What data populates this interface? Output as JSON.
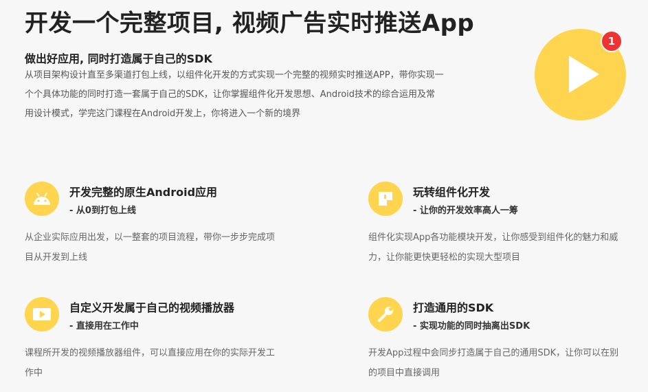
{
  "hero": {
    "title": "开发一个完整项目, 视频广告实时推送App",
    "subtitle": "做出好应用, 同时打造属于自己的SDK",
    "description": "从项目架构设计直至多渠道打包上线，以组件化开发的方式实现一个完整的视频实时推送APP，带你实现一个个具体功能的同时打造一套属于自己的SDK，让你掌握组件化开发思想、Android技术的综合运用及常用设计模式，学完这门课程在Android开发上，你将进入一个新的境界",
    "badge_count": "1"
  },
  "features": [
    {
      "icon": "android-icon",
      "title": "开发完整的原生Android应用",
      "subtitle": "- 从0到打包上线",
      "description": "从企业实际应用出发，以一整套的项目流程，带你一步步完成项目从开发到上线"
    },
    {
      "icon": "layout-icon",
      "title": "玩转组件化开发",
      "subtitle": "- 让你的开发效率高人一筹",
      "description": "组件化实现App各功能模块开发，让你感受到组件化的魅力和威力，让你能更快更轻松的实现大型项目"
    },
    {
      "icon": "video-player-icon",
      "title": "自定义开发属于自己的视频播放器",
      "subtitle": "- 直接用在工作中",
      "description": "课程所开发的视频播放器组件，可以直接应用在你的实际开发工作中"
    },
    {
      "icon": "wrench-icon",
      "title": "打造通用的SDK",
      "subtitle": "- 实现功能的同时抽离出SDK",
      "description": "开发App过程中会同步打造属于自己的通用SDK，让你可以在别的项目中直接调用"
    }
  ],
  "colors": {
    "accent": "#ffd54f",
    "badge": "#ee3333",
    "background": "#f7f7f7"
  }
}
